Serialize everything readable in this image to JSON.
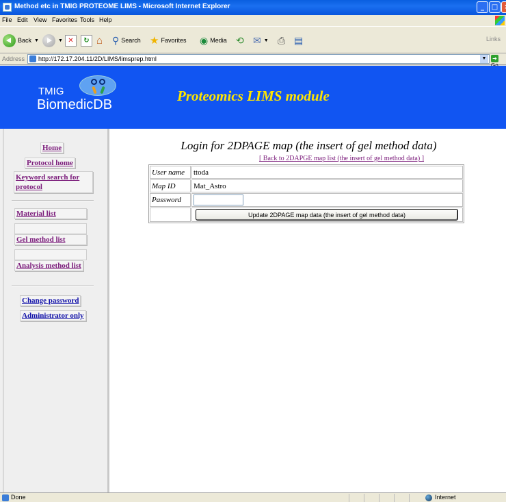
{
  "window": {
    "title": "Method etc in TMIG PROTEOME LIMS - Microsoft Internet Explorer"
  },
  "menu": [
    "File",
    "Edit",
    "View",
    "Favorites",
    "Tools",
    "Help"
  ],
  "toolbar": {
    "back": "Back",
    "search": "Search",
    "favorites": "Favorites",
    "media": "Media",
    "links": "Links"
  },
  "address": {
    "label": "Address",
    "url": "http://172.17.204.11/2D/LIMS/limsprep.html",
    "go": "Go"
  },
  "banner": {
    "logo_top": "TMIG",
    "logo_bottom": "BiomedicDB",
    "title": "Proteomics LIMS module"
  },
  "sidebar": {
    "home": "Home",
    "protocol_home": "Protocol home",
    "keyword_search": "Keyword search for protocol",
    "material_list": "Material list",
    "gel_method_list": "Gel method list",
    "analysis_method_list": "Analysis method list",
    "change_password": "Change password",
    "administrator_only": "Administrator only"
  },
  "main": {
    "heading": "Login for 2DPAGE map (the insert of gel method data)",
    "back_link": "[ Back to 2DAPGE map list (the insert of gel method data) ]",
    "form": {
      "user_name_label": "User name",
      "user_name_value": "ttoda",
      "map_id_label": "Map ID",
      "map_id_value": "Mat_Astro",
      "password_label": "Password",
      "password_value": "",
      "submit_label": "Update 2DPAGE map data (the insert of gel method data)"
    }
  },
  "status": {
    "text": "Done",
    "zone": "Internet"
  }
}
